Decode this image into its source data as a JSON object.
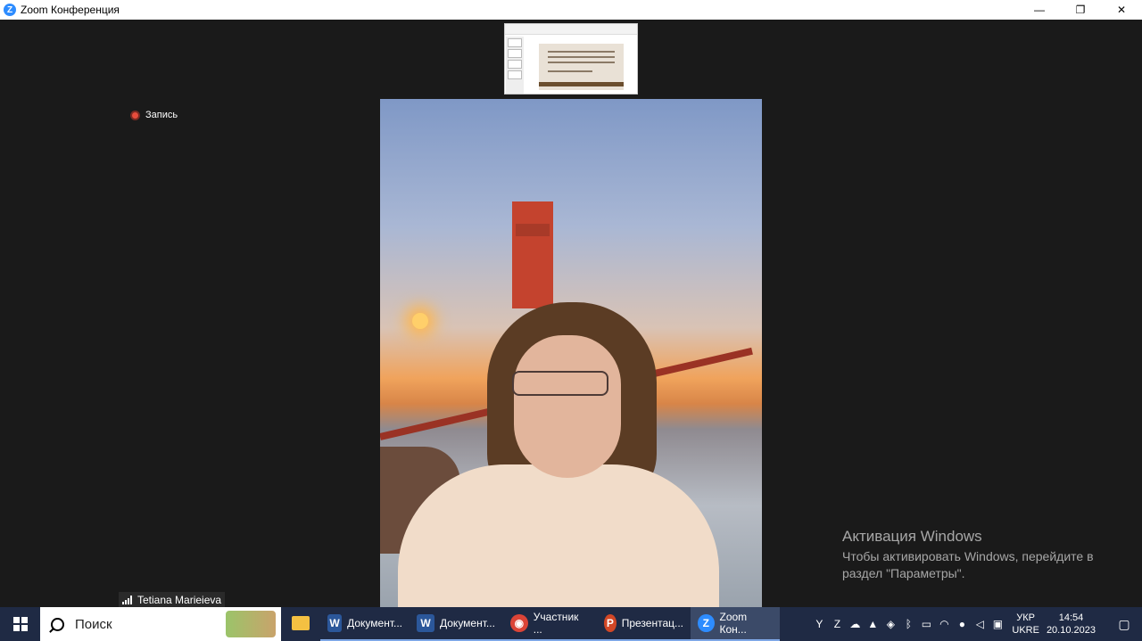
{
  "window": {
    "title": "Zoom Конференция",
    "minimize": "—",
    "maximize": "❐",
    "close": "✕",
    "app_icon": "Z"
  },
  "meeting": {
    "recording_label": "Запись",
    "participant_name": "Tetiana Marieieva"
  },
  "activation": {
    "heading": "Активация Windows",
    "text": "Чтобы активировать Windows, перейдите в раздел \"Параметры\"."
  },
  "taskbar": {
    "search_placeholder": "Поиск",
    "items": [
      {
        "label": "Документ...",
        "icon": "W",
        "color": "#2b579a"
      },
      {
        "label": "Документ...",
        "icon": "W",
        "color": "#2b579a"
      },
      {
        "label": "Участник ...",
        "icon": "◉",
        "color": "#db4437"
      },
      {
        "label": "Презентац...",
        "icon": "P",
        "color": "#d24726"
      },
      {
        "label": "Zoom Кон...",
        "icon": "Z",
        "color": "#2d8cff"
      }
    ],
    "language": {
      "line1": "УКР",
      "line2": "UKRE"
    },
    "clock": {
      "time": "14:54",
      "date": "20.10.2023"
    }
  }
}
